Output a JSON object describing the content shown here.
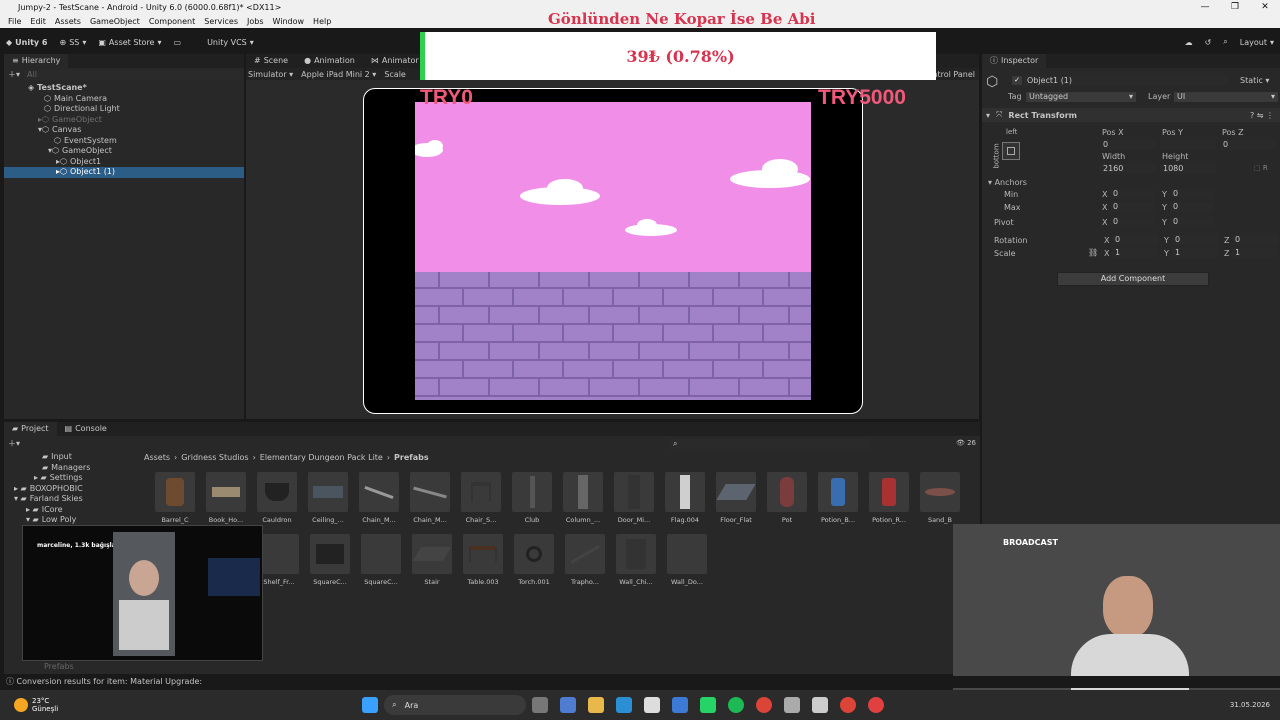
{
  "window": {
    "title": "Jumpy-2 - TestScane - Android - Unity 6.0 (6000.0.68f1)* <DX11>",
    "minimize": "—",
    "maximize": "❐",
    "close": "✕"
  },
  "menu": [
    "File",
    "Edit",
    "Assets",
    "GameObject",
    "Component",
    "Services",
    "Jobs",
    "Window",
    "Help"
  ],
  "overlay": {
    "headline": "Gönlünden Ne Kopar İse Be Abi",
    "price": "39₺ (0.78%)"
  },
  "toolbar": {
    "unity": "Unity 6",
    "account": "SS",
    "asset_store": "Asset Store",
    "vcs": "Unity VCS",
    "layout": "Layout"
  },
  "hierarchy": {
    "tab": "Hierarchy",
    "search_placeholder": "All",
    "items": [
      {
        "label": "TestScane*"
      },
      {
        "label": "Main Camera"
      },
      {
        "label": "Directional Light"
      },
      {
        "label": "GameObject"
      },
      {
        "label": "Canvas"
      },
      {
        "label": "EventSystem"
      },
      {
        "label": "GameObject"
      },
      {
        "label": "Object1"
      },
      {
        "label": "Object1 (1)"
      }
    ]
  },
  "scene": {
    "tabs": [
      "Scene",
      "Animation",
      "Animator"
    ],
    "simulator": "Simulator",
    "device": "Apple iPad Mini 2",
    "scale": "Scale",
    "control_panel": "Control Panel",
    "score_left": "TRY0",
    "score_right": "TRY5000"
  },
  "inspector": {
    "tab": "Inspector",
    "object_name": "Object1 (1)",
    "static": "Static",
    "tag_label": "Tag",
    "tag_value": "Untagged",
    "layer_label": "Layer",
    "layer_value": "UI",
    "component": "Rect Transform",
    "anchor_left": "left",
    "anchor_bottom": "bottom",
    "pos_x_label": "Pos X",
    "pos_x": "0",
    "pos_y_label": "Pos Y",
    "pos_y": "",
    "pos_z_label": "Pos Z",
    "pos_z": "0",
    "width_label": "Width",
    "width": "2160",
    "height_label": "Height",
    "height": "1080",
    "anchors": "Anchors",
    "min": "Min",
    "max": "Max",
    "pivot": "Pivot",
    "min_x": "0",
    "min_y": "0",
    "max_x": "0",
    "max_y": "0",
    "pivot_x": "0",
    "pivot_y": "0",
    "rotation": "Rotation",
    "rot_x": "0",
    "rot_y": "0",
    "rot_z": "0",
    "scale": "Scale",
    "scale_x": "1",
    "scale_y": "1",
    "scale_z": "1",
    "add_component": "Add Component"
  },
  "project": {
    "tabs": [
      "Project",
      "Console"
    ],
    "tree": [
      "Input",
      "Managers",
      "Settings",
      "BOXOPHOBIC",
      "Farland Skies",
      "ICore",
      "Low Poly"
    ],
    "tree_bottom": "Prefabs",
    "breadcrumb": [
      "Assets",
      "Gridness Studios",
      "Elementary Dungeon Pack Lite",
      "Prefabs"
    ],
    "count": "26",
    "assets_row1": [
      "Barrel_C",
      "Book_Ho...",
      "Cauldron",
      "Ceiling_...",
      "Chain_M...",
      "Chain_M...",
      "Chair_S...",
      "Club",
      "Column_...",
      "Door_Mi...",
      "Flag.004",
      "Floor_Flat",
      "Pot",
      "Potion_B...",
      "Potion_R...",
      "Sand_B"
    ],
    "assets_row2": [
      "Shelf_Fr...",
      "SquareC...",
      "SquareC...",
      "Stair",
      "Table.003",
      "Torch.001",
      "Trapho...",
      "Wall_Chi...",
      "Wall_Do..."
    ]
  },
  "status": {
    "message": "Conversion results for item: Material Upgrade:"
  },
  "webcam": {
    "label": "BROADCAST"
  },
  "chat": {
    "user": "marceline, 1.3k bağışladı!"
  },
  "taskbar": {
    "weather_temp": "23°C",
    "weather_desc": "Güneşli",
    "search": "Ara",
    "date": "31.05.2026"
  }
}
